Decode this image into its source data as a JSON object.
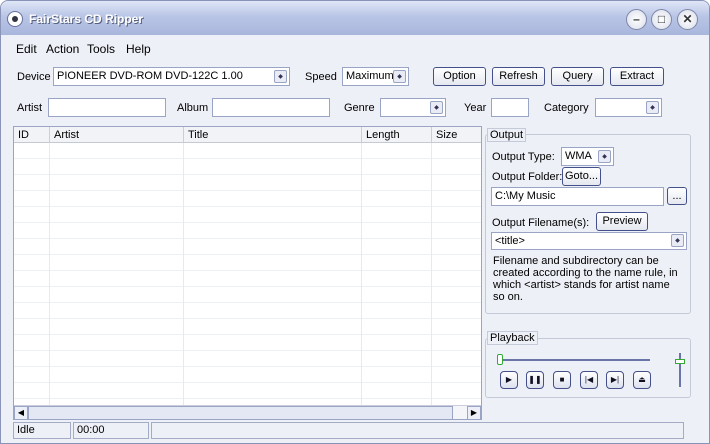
{
  "window": {
    "title": "FairStars CD Ripper"
  },
  "menu": [
    "Edit",
    "Action",
    "Tools",
    "Help"
  ],
  "toolbar": {
    "device_label": "Device",
    "device_value": "PIONEER DVD-ROM DVD-122C 1.00",
    "speed_label": "Speed",
    "speed_value": "Maximum",
    "option": "Option",
    "refresh": "Refresh",
    "query": "Query",
    "extract": "Extract"
  },
  "tags": {
    "artist_label": "Artist",
    "artist_value": "",
    "album_label": "Album",
    "album_value": "",
    "genre_label": "Genre",
    "genre_value": "",
    "year_label": "Year",
    "year_value": "",
    "category_label": "Category",
    "category_value": ""
  },
  "table": {
    "columns": [
      "ID",
      "Artist",
      "Title",
      "Length",
      "Size"
    ]
  },
  "output": {
    "group": "Output",
    "type_label": "Output Type:",
    "type_value": "WMA",
    "folder_label": "Output Folder:",
    "goto": "Goto...",
    "folder_value": "C:\\My Music",
    "browse": "...",
    "filename_label": "Output Filename(s):",
    "preview": "Preview",
    "filename_value": "<title>",
    "help": [
      "Filename and subdirectory can be",
      "created according to the name rule, in",
      "which <artist> stands for artist name",
      "so on."
    ]
  },
  "playback": {
    "group": "Playback",
    "position": 0,
    "volume": 0.2
  },
  "status": {
    "state": "Idle",
    "time": "00:00",
    "info": ""
  }
}
